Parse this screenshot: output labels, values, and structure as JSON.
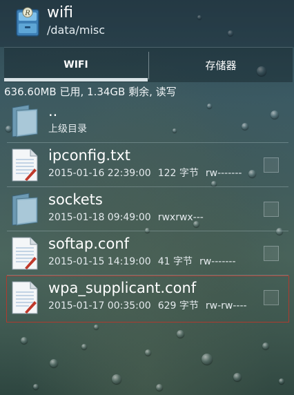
{
  "header": {
    "title": "wifi",
    "path": "/data/misc"
  },
  "tabs": [
    {
      "label": "WIFI",
      "active": true
    },
    {
      "label": "存储器",
      "active": false
    }
  ],
  "storage_info": "636.60MB 已用, 1.34GB 剩余, 读写",
  "files": [
    {
      "name": "..",
      "desc": "上级目录",
      "type": "folder"
    },
    {
      "name": "ipconfig.txt",
      "date": "2015-01-16 22:39:00",
      "size": "122 字节",
      "perm": "rw-------",
      "type": "file"
    },
    {
      "name": "sockets",
      "date": "2015-01-18 09:49:00",
      "size": "",
      "perm": "rwxrwx---",
      "type": "folder"
    },
    {
      "name": "softap.conf",
      "date": "2015-01-15 14:19:00",
      "size": "41 字节",
      "perm": "rw-------",
      "type": "file"
    },
    {
      "name": "wpa_supplicant.conf",
      "date": "2015-01-17 00:35:00",
      "size": "629 字节",
      "perm": "rw-rw----",
      "type": "file",
      "selected": true
    }
  ],
  "colors": {
    "accent": "#d8e2e6",
    "selection_border": "#b03a2e"
  },
  "icons": {
    "app": "file-manager-app-icon",
    "folder": "folder-icon",
    "file": "text-file-icon"
  }
}
